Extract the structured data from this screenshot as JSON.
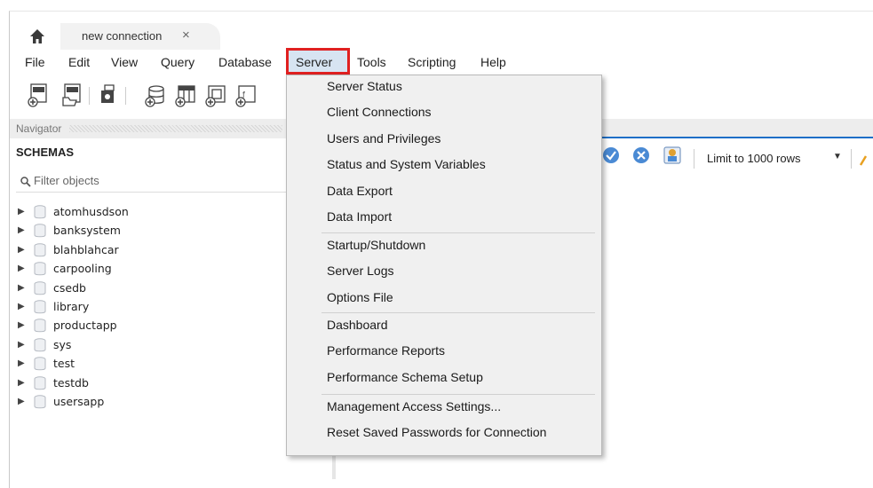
{
  "tabs": {
    "home_icon": "home-icon",
    "connection_label": "new connection",
    "close_glyph": "×"
  },
  "menubar": [
    "File",
    "Edit",
    "View",
    "Query",
    "Database",
    "Server",
    "Tools",
    "Scripting",
    "Help"
  ],
  "navigator": {
    "header": "Navigator",
    "schemas_title": "SCHEMAS",
    "filter_placeholder": "Filter objects",
    "schemas": [
      "atomhusdson",
      "banksystem",
      "blahblahcar",
      "carpooling",
      "csedb",
      "library",
      "productapp",
      "sys",
      "test",
      "testdb",
      "usersapp"
    ]
  },
  "server_menu": {
    "group1": [
      "Server Status",
      "Client Connections",
      "Users and Privileges",
      "Status and System Variables",
      "Data Export",
      "Data Import"
    ],
    "group2": [
      "Startup/Shutdown",
      "Server Logs",
      "Options File"
    ],
    "group3": [
      "Dashboard",
      "Performance Reports",
      "Performance Schema Setup"
    ],
    "group4": [
      "Management Access Settings...",
      "Reset Saved Passwords for Connection"
    ]
  },
  "query_toolbar": {
    "limit_label": "Limit to 1000 rows"
  },
  "colors": {
    "highlight_border": "#e02020",
    "accent_blue": "#1e6fc7",
    "menu_bg": "#f0f0f0"
  }
}
